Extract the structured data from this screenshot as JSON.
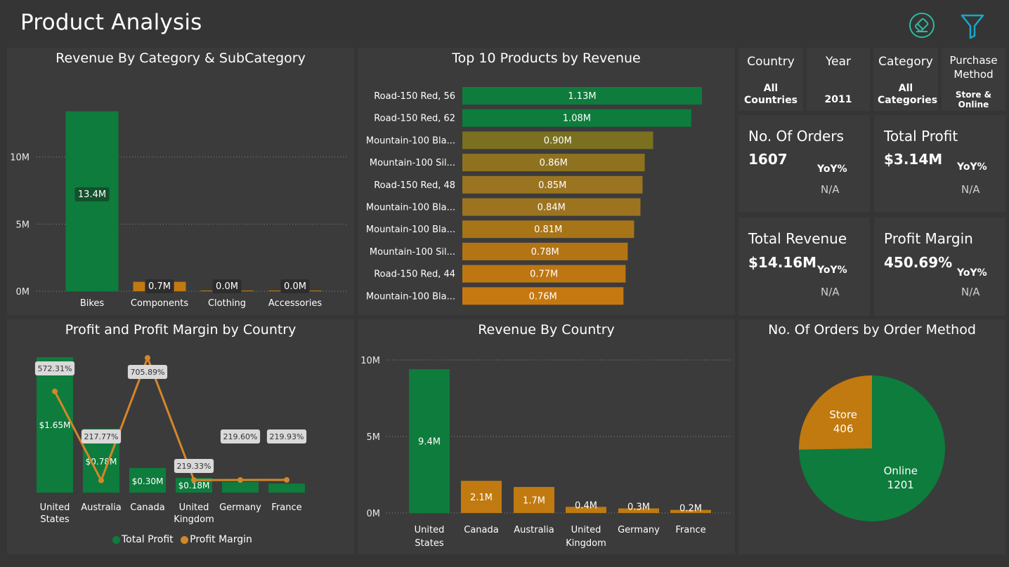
{
  "page": {
    "title": "Product Analysis"
  },
  "toolbar": {
    "eraser_icon": "eraser-icon",
    "filter_icon": "filter-icon"
  },
  "colors": {
    "green": "#0e7c3c",
    "gold": "#c07a10",
    "panel": "#3b3b3b",
    "bg": "#353535",
    "line": "#d4862a"
  },
  "category_chart": {
    "title": "Revenue By Category & SubCategory",
    "chart_data": {
      "type": "bar",
      "categories": [
        "Bikes",
        "Components",
        "Clothing",
        "Accessories"
      ],
      "values": [
        13.4,
        0.7,
        0.02,
        0.02
      ],
      "data_labels": [
        "13.4M",
        "0.7M",
        "0.0M",
        "0.0M"
      ],
      "yticks": [
        "0M",
        "5M",
        "10M"
      ],
      "ylim": [
        0,
        15
      ]
    }
  },
  "top_products": {
    "title": "Top 10 Products by Revenue",
    "chart_data": {
      "type": "bar",
      "orientation": "horizontal",
      "categories": [
        "Road-150 Red, 56",
        "Road-150 Red, 62",
        "Mountain-100 Bla...",
        "Mountain-100 Sil...",
        "Road-150 Red, 48",
        "Mountain-100 Bla...",
        "Mountain-100 Bla...",
        "Mountain-100 Sil...",
        "Road-150 Red, 44",
        "Mountain-100 Bla..."
      ],
      "values": [
        1.13,
        1.08,
        0.9,
        0.86,
        0.85,
        0.84,
        0.81,
        0.78,
        0.77,
        0.76
      ],
      "data_labels": [
        "1.13M",
        "1.08M",
        "0.90M",
        "0.86M",
        "0.85M",
        "0.84M",
        "0.81M",
        "0.78M",
        "0.77M",
        "0.76M"
      ],
      "colors": [
        "#0e7c3c",
        "#0e7c3c",
        "#7a7020",
        "#8f7220",
        "#9a7420",
        "#9c7420",
        "#a87418",
        "#b47414",
        "#be7612",
        "#c67810"
      ]
    }
  },
  "filters": [
    {
      "label": "Country",
      "value": "All Countries"
    },
    {
      "label": "Year",
      "value": "2011"
    },
    {
      "label": "Category",
      "value": "All Categories"
    },
    {
      "label": "Purchase Method",
      "value": "Store & Online"
    }
  ],
  "kpis": [
    {
      "label": "No. Of Orders",
      "value": "1607",
      "yoy_label": "YoY%",
      "yoy_value": "N/A"
    },
    {
      "label": "Total Profit",
      "value": "$3.14M",
      "yoy_label": "YoY%",
      "yoy_value": "N/A"
    },
    {
      "label": "Total Revenue",
      "value": "$14.16M",
      "yoy_label": "YoY%",
      "yoy_value": "N/A"
    },
    {
      "label": "Profit Margin",
      "value": "450.69%",
      "yoy_label": "YoY%",
      "yoy_value": "N/A"
    }
  ],
  "profit_chart": {
    "title": "Profit and Profit Margin by Country",
    "legend": [
      "Total Profit",
      "Profit Margin"
    ],
    "chart_data": {
      "type": "bar",
      "categories": [
        "United States",
        "Australia",
        "Canada",
        "United Kingdom",
        "Germany",
        "France"
      ],
      "series": [
        {
          "name": "Total Profit",
          "values": [
            1.65,
            0.78,
            0.3,
            0.18,
            0.13,
            0.11
          ],
          "labels": [
            "$1.65M",
            "$0.78M",
            "$0.30M",
            "$0.18M",
            "",
            ""
          ]
        },
        {
          "name": "Profit Margin",
          "values": [
            572.31,
            217.77,
            705.89,
            219.33,
            219.6,
            219.93
          ],
          "labels": [
            "572.31%",
            "217.77%",
            "705.89%",
            "219.33%",
            "219.60%",
            "219.93%"
          ]
        }
      ]
    }
  },
  "country_chart": {
    "title": "Revenue By Country",
    "chart_data": {
      "type": "bar",
      "categories": [
        "United States",
        "Canada",
        "Australia",
        "United Kingdom",
        "Germany",
        "France"
      ],
      "values": [
        9.4,
        2.1,
        1.7,
        0.4,
        0.3,
        0.2
      ],
      "data_labels": [
        "9.4M",
        "2.1M",
        "1.7M",
        "0.4M",
        "0.3M",
        "0.2M"
      ],
      "yticks": [
        "0M",
        "5M",
        "10M"
      ],
      "ylim": [
        0,
        10
      ]
    }
  },
  "orders_chart": {
    "title": "No. Of Orders by Order Method",
    "chart_data": {
      "type": "pie",
      "categories": [
        "Online",
        "Store"
      ],
      "values": [
        1201,
        406
      ]
    }
  }
}
